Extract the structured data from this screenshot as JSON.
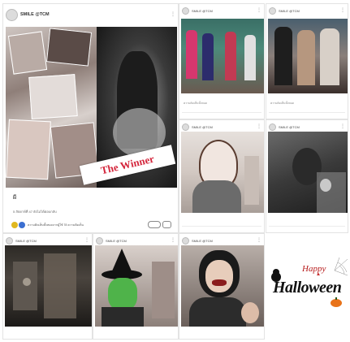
{
  "main_post": {
    "account_name": "SMILE @TCM",
    "caption": "ผี",
    "meta": "5 สัปดาห์ที่ 47 ยังไม่ได้ตอบกลับ",
    "badge_text": "The Winner",
    "reaction_text": "ความคิดเห็นทั้งหมดจากผู้ใช้ 78 ความคิดเห็น"
  },
  "posts": [
    {
      "account_name": "SMILE @TCM",
      "caption": "",
      "meta": "ความคิดเห็นทั้งหมด"
    },
    {
      "account_name": "SMILE @TCM",
      "caption": "",
      "meta": "ความคิดเห็นทั้งหมด"
    },
    {
      "account_name": "SMILE @TCM",
      "caption": "",
      "meta": ""
    },
    {
      "account_name": "SMILE @TCM",
      "caption": "",
      "meta": ""
    },
    {
      "account_name": "SMILE @TCM",
      "caption": "",
      "meta": ""
    },
    {
      "account_name": "SMILE @TCM",
      "caption": "",
      "meta": ""
    },
    {
      "account_name": "SMILE @TCM",
      "caption": "",
      "meta": ""
    }
  ],
  "halloween": {
    "line1": "Happy",
    "line2": "Halloween"
  },
  "colors": {
    "winner_red": "#d4263c",
    "halloween_orange": "#e8731a"
  }
}
